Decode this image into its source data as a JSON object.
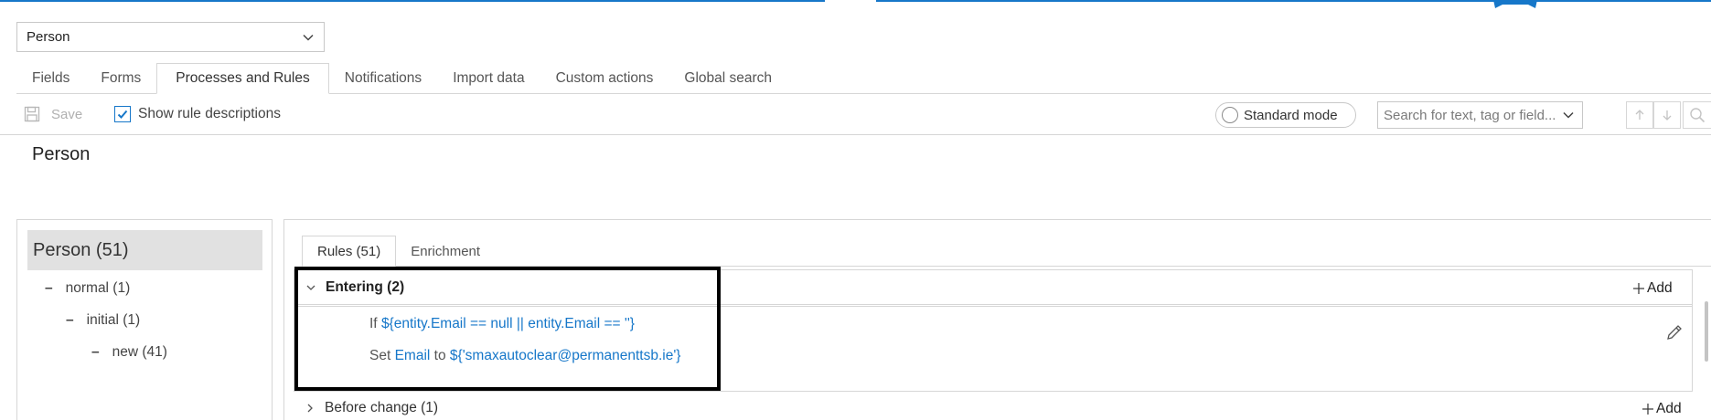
{
  "entity_selector": {
    "value": "Person"
  },
  "tabs": [
    {
      "label": "Fields",
      "active": false
    },
    {
      "label": "Forms",
      "active": false
    },
    {
      "label": "Processes and Rules",
      "active": true
    },
    {
      "label": "Notifications",
      "active": false
    },
    {
      "label": "Import data",
      "active": false
    },
    {
      "label": "Custom actions",
      "active": false
    },
    {
      "label": "Global search",
      "active": false
    }
  ],
  "toolbar": {
    "save_label": "Save",
    "show_descriptions_label": "Show rule descriptions",
    "show_descriptions_checked": true,
    "mode_label": "Standard mode",
    "search_placeholder": "Search for text, tag or field..."
  },
  "page_title": "Person",
  "tree": {
    "root": "Person (51)",
    "items": [
      {
        "label": "normal (1)",
        "level": 1
      },
      {
        "label": "initial (1)",
        "level": 2
      },
      {
        "label": "new (41)",
        "level": 3
      }
    ]
  },
  "rule_tabs": [
    {
      "label": "Rules (51)",
      "active": true
    },
    {
      "label": "Enrichment",
      "active": false
    }
  ],
  "sections": {
    "entering": {
      "title": "Entering (2)",
      "add_label": "Add",
      "rules": [
        {
          "keyword": "If",
          "expression": "${entity.Email == null || entity.Email == ''}"
        },
        {
          "keyword": "Set",
          "field": "Email",
          "to": "to",
          "expression": "${'smaxautoclear@permanenttsb.ie'}"
        }
      ]
    },
    "before_change": {
      "title": "Before change (1)",
      "add_label": "Add"
    }
  },
  "colors": {
    "accent": "#1677c9",
    "highlight": "#000000"
  },
  "icons": [
    "chevron-down-icon",
    "save-icon",
    "checkmark-icon",
    "arrow-up-icon",
    "arrow-down-icon",
    "search-icon",
    "plus-icon",
    "pencil-icon",
    "chevron-right-icon",
    "bookmark-ribbon-icon"
  ]
}
